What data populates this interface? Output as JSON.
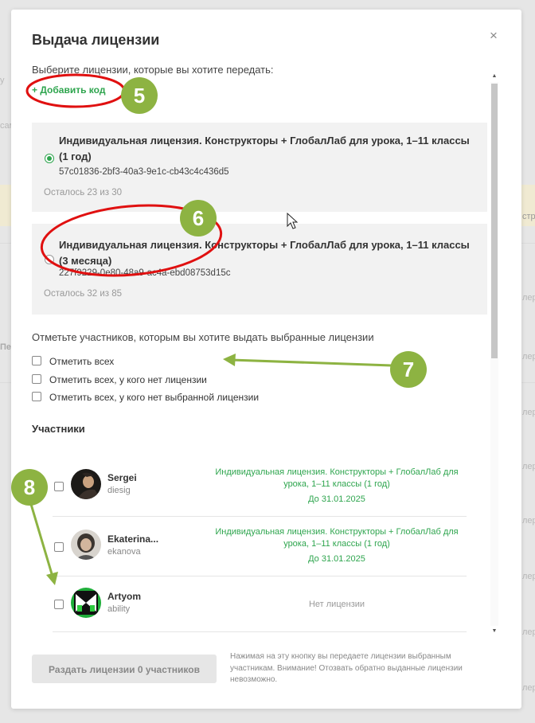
{
  "background": {
    "snippets": [
      "у",
      "сам",
      "Пе",
      "стри",
      "лер",
      "лер",
      "лер",
      "лер",
      "лер",
      "лер",
      "лер",
      "лер"
    ]
  },
  "modal": {
    "title": "Выдача лицензии",
    "close_glyph": "×",
    "intro": "Выберите лицензии, которые вы хотите передать:",
    "add_code": "+ Добавить код",
    "licenses": [
      {
        "name": "Индивидуальная лицензия. Конструкторы + ГлобалЛаб для урока, 1–11 классы (1 год)",
        "code": "57c01836-2bf3-40a3-9e1c-cb43c4c436d5",
        "remaining": "Осталось 23 из 30",
        "selected": true
      },
      {
        "name": "Индивидуальная лицензия. Конструкторы + ГлобалЛаб для урока, 1–11 классы (3 месяца)",
        "code": "227f9229-0e80-48a9-ac4a-ebd08753d15c",
        "remaining": "Осталось 32 из 85",
        "selected": false
      }
    ],
    "mark_title": "Отметьте участников, которым вы хотите выдать выбранные лицензии",
    "mark_options": [
      "Отметить всех",
      "Отметить всех, у кого нет лицензии",
      "Отметить всех, у кого нет выбранной лицензии"
    ],
    "participants_title": "Участники",
    "participants": [
      {
        "name": "Sergei",
        "login": "diesig",
        "license": "Индивидуальная лицензия. Конструкторы + ГлобалЛаб для урока, 1–11 классы (1 год)",
        "until": "До 31.01.2025"
      },
      {
        "name": "Ekaterina...",
        "login": "ekanova",
        "license": "Индивидуальная лицензия. Конструкторы + ГлобалЛаб для урока, 1–11 классы (1 год)",
        "until": "До 31.01.2025"
      },
      {
        "name": "Artyom",
        "login": "ability",
        "license": "Нет лицензии",
        "until": ""
      }
    ],
    "submit_label": "Раздать лицензии 0 участников",
    "warning": "Нажимая на эту кнопку вы передаете лицензии выбранным участникам. Внимание! Отозвать обратно выданные лицензии невозможно.",
    "scroll_up": "▲",
    "scroll_down": "▼"
  },
  "annotations": {
    "badges": [
      "5",
      "6",
      "7",
      "8"
    ],
    "ellipse_color": "#e01010",
    "badge_color": "#8db342"
  }
}
